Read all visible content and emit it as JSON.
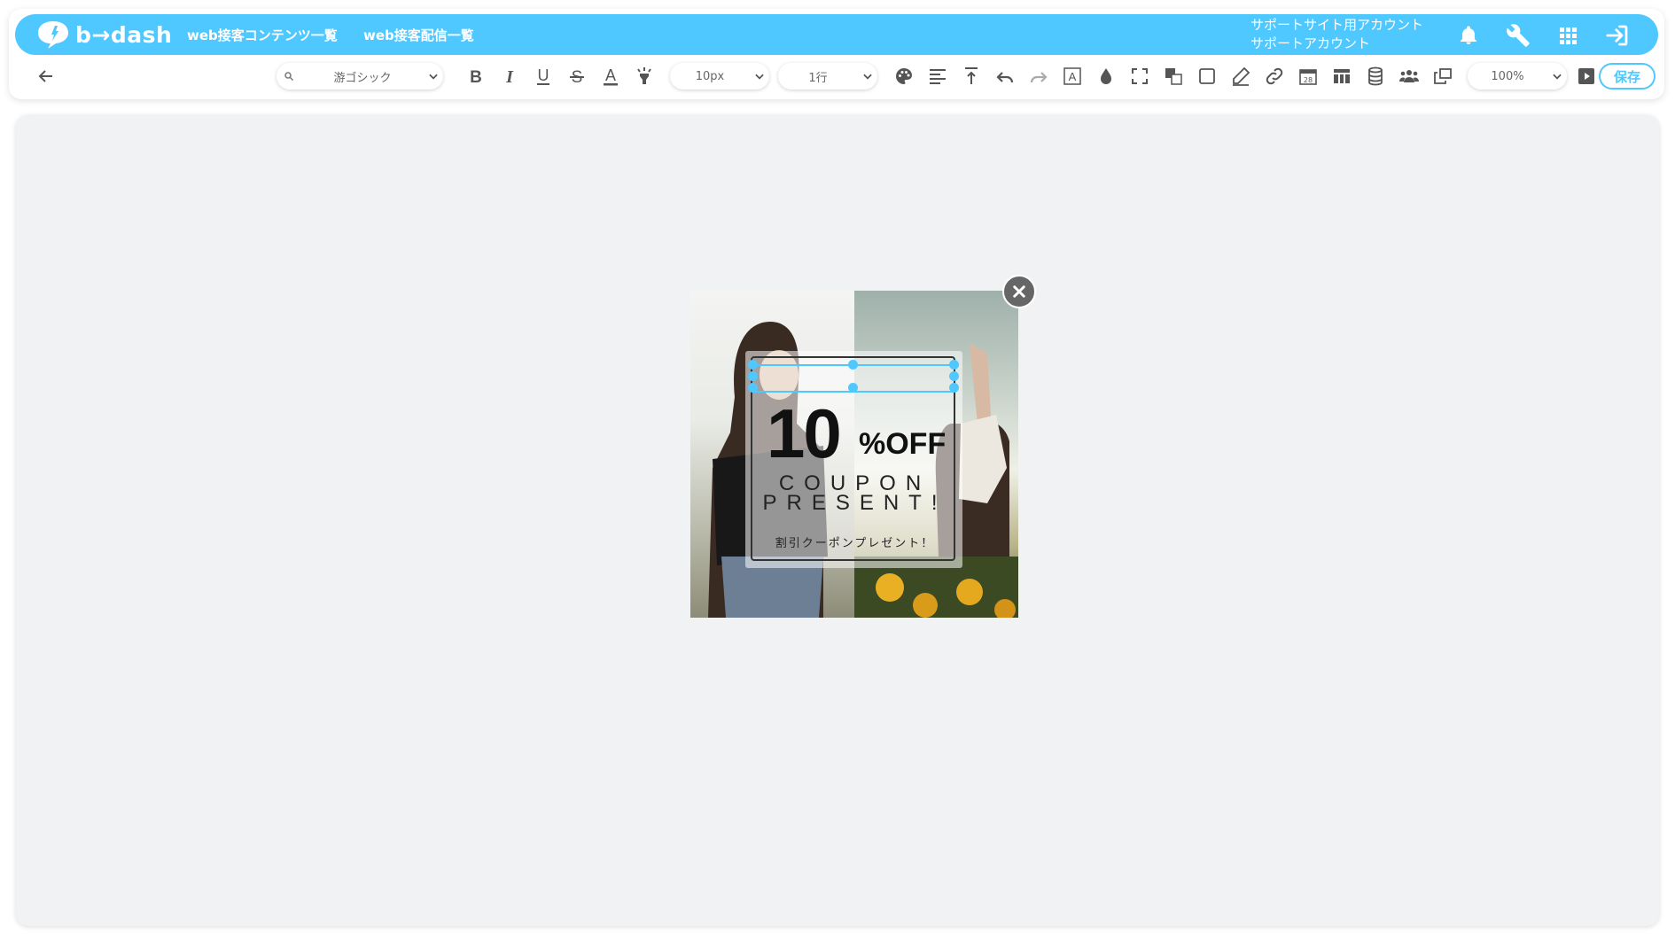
{
  "header": {
    "logo_text": "b→dash",
    "nav": [
      "web接客コンテンツ一覧",
      "web接客配信一覧"
    ],
    "account_line1": "サポートサイト用アカウント",
    "account_line2": "サポートアカウント",
    "icons": [
      "bell-icon",
      "wrench-icon",
      "grid-icon",
      "logout-icon"
    ]
  },
  "toolbar": {
    "font_family": "游ゴシック",
    "font_size": "10px",
    "line_height": "1行",
    "zoom": "100%",
    "save_label": "保存"
  },
  "popup": {
    "discount_number": "10",
    "discount_suffix": "%OFF",
    "line1": "COUPON",
    "line2": "PRESENT!",
    "subtitle": "割引クーポンプレゼント！"
  },
  "colors": {
    "brand": "#4fc8ff",
    "canvas_bg": "#f1f2f4",
    "close_btn": "#666666"
  }
}
